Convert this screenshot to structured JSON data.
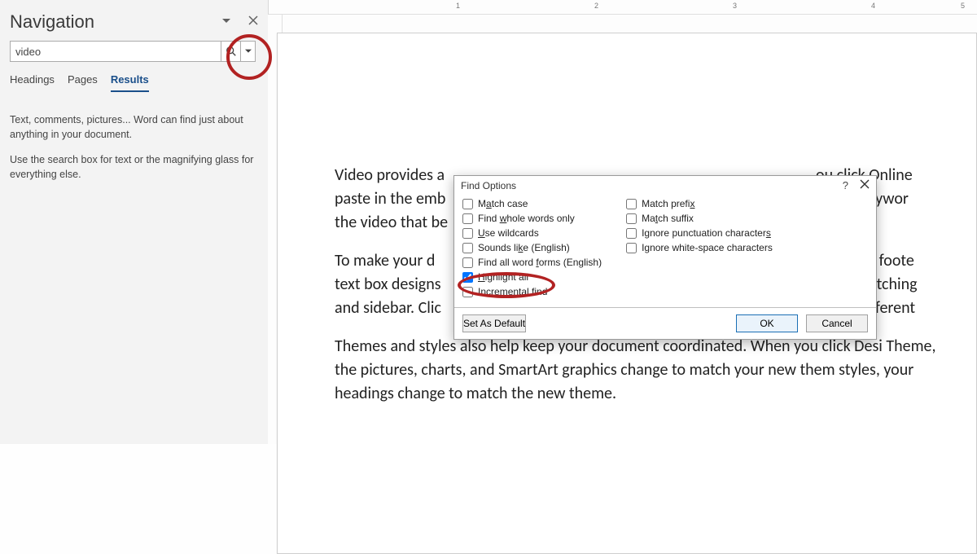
{
  "nav": {
    "title": "Navigation",
    "search_value": "video",
    "tabs": [
      "Headings",
      "Pages",
      "Results"
    ],
    "active_tab_index": 2,
    "hint1": "Text, comments, pictures... Word can find just about anything in your document.",
    "hint2": "Use the search box for text or the magnifying glass for everything else."
  },
  "ruler_marks": [
    "1",
    "2",
    "3",
    "4",
    "5"
  ],
  "doc": {
    "p1": "Video provides a\npaste in the emb\nthe video that be",
    "p1b": "ou click Online\ntype a keywor",
    "p2": "To make your d\ntext box designs\nand sidebar. Clic",
    "p2b": "s header, foote\nadd a matching\nm the different",
    "p3": "Themes and styles also help keep your document coordinated. When you click Desi Theme, the pictures, charts, and SmartArt graphics change to match your new them styles, your headings change to match the new theme."
  },
  "dialog": {
    "title": "Find Options",
    "help_symbol": "?",
    "options_left": [
      {
        "label_pre": "M",
        "label_ul": "a",
        "label_post": "tch case",
        "checked": false
      },
      {
        "label_pre": "Find ",
        "label_ul": "w",
        "label_post": "hole words only",
        "checked": false
      },
      {
        "label_pre": "",
        "label_ul": "U",
        "label_post": "se wildcards",
        "checked": false
      },
      {
        "label_pre": "Sounds li",
        "label_ul": "k",
        "label_post": "e (English)",
        "checked": false
      },
      {
        "label_pre": "Find all word ",
        "label_ul": "f",
        "label_post": "orms (English)",
        "checked": false
      },
      {
        "label_pre": "",
        "label_ul": "H",
        "label_post": "ighlight all",
        "checked": true
      },
      {
        "label_pre": "Incre",
        "label_ul": "m",
        "label_post": "ental find",
        "checked": false
      }
    ],
    "options_right": [
      {
        "label_pre": "Match prefi",
        "label_ul": "x",
        "label_post": "",
        "checked": false
      },
      {
        "label_pre": "Ma",
        "label_ul": "t",
        "label_post": "ch suffix",
        "checked": false
      },
      {
        "label_pre": "Ignore punctuation character",
        "label_ul": "s",
        "label_post": "",
        "checked": false
      },
      {
        "label_pre": "Ignore white-space characters",
        "label_ul": "",
        "label_post": "",
        "checked": false
      }
    ],
    "set_default": "Set As Default",
    "ok": "OK",
    "cancel": "Cancel"
  }
}
